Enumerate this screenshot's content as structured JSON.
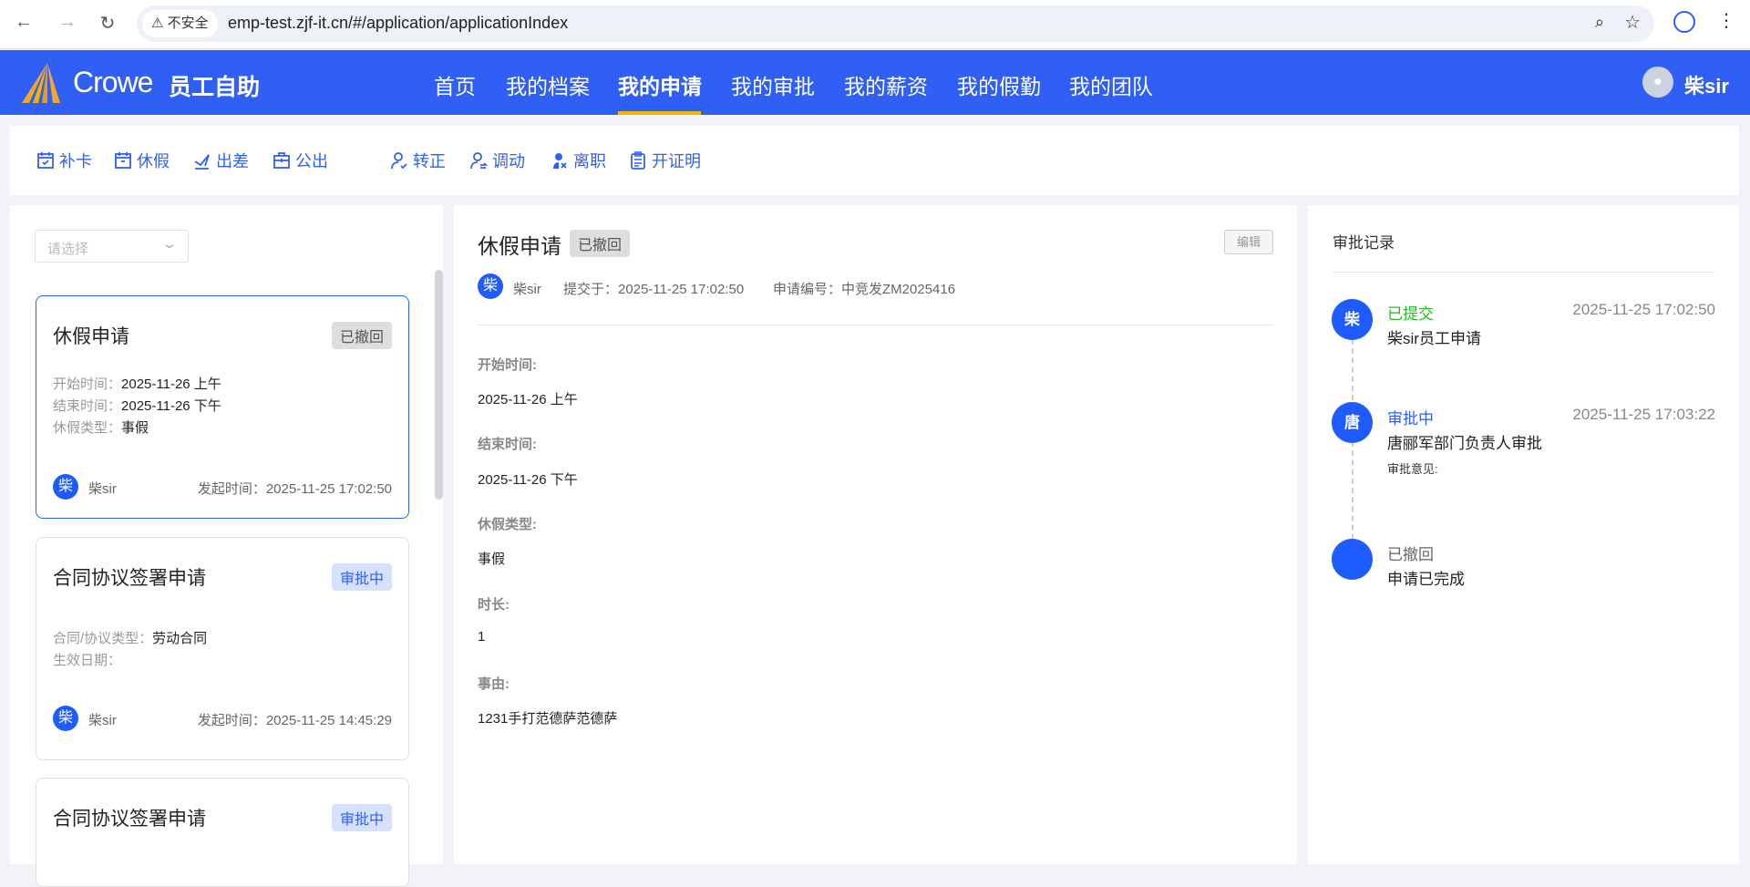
{
  "browser": {
    "security": "不安全",
    "url": "emp-test.zjf-it.cn/#/application/applicationIndex"
  },
  "header": {
    "brand": "Crowe",
    "app": "员工自助",
    "nav": [
      "首页",
      "我的档案",
      "我的申请",
      "我的审批",
      "我的薪资",
      "我的假勤",
      "我的团队"
    ],
    "active": "我的申请",
    "user": "柴sir"
  },
  "toolbar": [
    "补卡",
    "休假",
    "出差",
    "公出",
    "转正",
    "调动",
    "离职",
    "开证明"
  ],
  "list": {
    "select_placeholder": "请选择",
    "cards": [
      {
        "title": "休假申请",
        "status": "已撤回",
        "fields": [
          [
            "开始时间：",
            "2025-11-26 上午"
          ],
          [
            "结束时间：",
            "2025-11-26 下午"
          ],
          [
            "休假类型：",
            "事假"
          ]
        ],
        "avatar": "柴",
        "user": "柴sir",
        "time_label": "发起时间：",
        "time": "2025-11-25 17:02:50"
      },
      {
        "title": "合同协议签署申请",
        "status": "审批中",
        "fields": [
          [
            "合同/协议类型：",
            "劳动合同"
          ],
          [
            "生效日期：",
            ""
          ]
        ],
        "avatar": "柴",
        "user": "柴sir",
        "time_label": "发起时间：",
        "time": "2025-11-25 14:45:29"
      },
      {
        "title": "合同协议签署申请",
        "status": "审批中"
      }
    ]
  },
  "detail": {
    "title": "休假申请",
    "status": "已撤回",
    "edit": "编辑",
    "avatar": "柴",
    "user": "柴sir",
    "submitted": "提交于：2025-11-25 17:02:50",
    "number": "申请编号：中竞发ZM2025416",
    "fields": [
      [
        "开始时间:",
        "2025-11-26 上午"
      ],
      [
        "结束时间:",
        "2025-11-26 下午"
      ],
      [
        "休假类型:",
        "事假"
      ],
      [
        "时长:",
        "1"
      ],
      [
        "事由:",
        "1231手打范德萨范德萨"
      ]
    ]
  },
  "records": {
    "title": "审批记录",
    "items": [
      {
        "avatar": "柴",
        "status": "已提交",
        "time": "2025-11-25 17:02:50",
        "desc": "柴sir员工申请",
        "color": "#22c01e"
      },
      {
        "avatar": "唐",
        "status": "审批中",
        "time": "2025-11-25 17:03:22",
        "desc": "唐郦军部门负责人审批",
        "opinion": "审批意见:",
        "color": "#2f5ff5"
      },
      {
        "avatar": "",
        "status": "已撤回",
        "desc": "申请已完成",
        "color": "#666"
      }
    ]
  }
}
